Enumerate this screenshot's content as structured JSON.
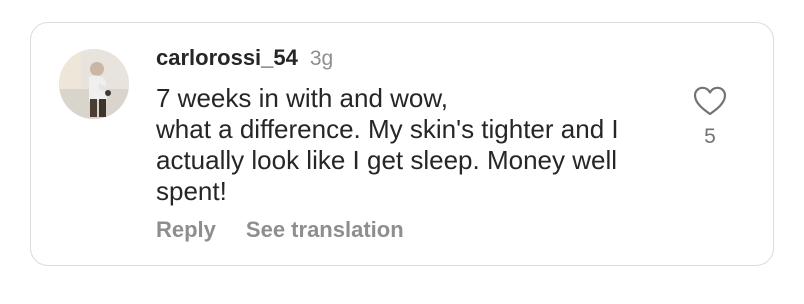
{
  "comment": {
    "username": "carlorossi_54",
    "time": "3g",
    "lines": [
      "7 weeks in with and wow,",
      "what a difference. My skin's tighter and I",
      "actually look like I get sleep. Money well",
      "spent!"
    ],
    "like_count": "5",
    "actions": {
      "reply_label": "Reply",
      "see_translation_label": "See translation"
    },
    "icons": {
      "like": "heart-outline-icon",
      "avatar": "profile-photo"
    }
  }
}
